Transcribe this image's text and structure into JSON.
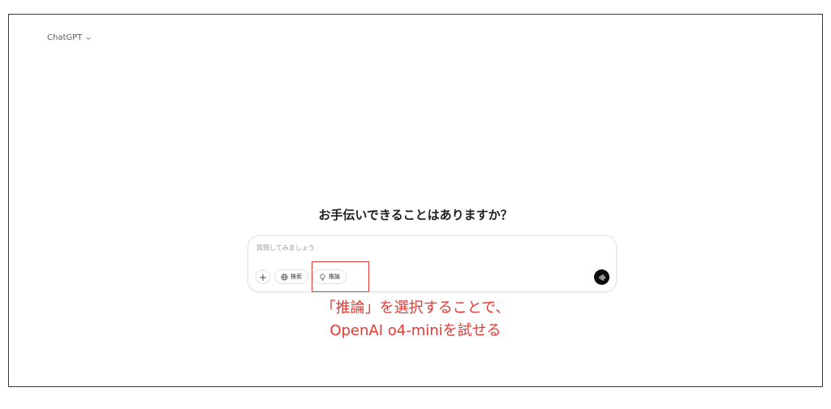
{
  "header": {
    "model_name": "ChatGPT"
  },
  "main": {
    "greeting": "お手伝いできることはありますか？"
  },
  "composer": {
    "placeholder": "質問してみましょう",
    "tools": {
      "search_label": "検索",
      "reason_label": "推論"
    }
  },
  "annotation": {
    "line1": "「推論」を選択することで、",
    "line2": "OpenAI o4-miniを試せる",
    "color": "#e53935"
  },
  "icons": {
    "model_dropdown": "chevron-down-icon",
    "add": "plus-icon",
    "search": "globe-icon",
    "reason": "lightbulb-icon",
    "voice": "voice-waveform-icon"
  }
}
